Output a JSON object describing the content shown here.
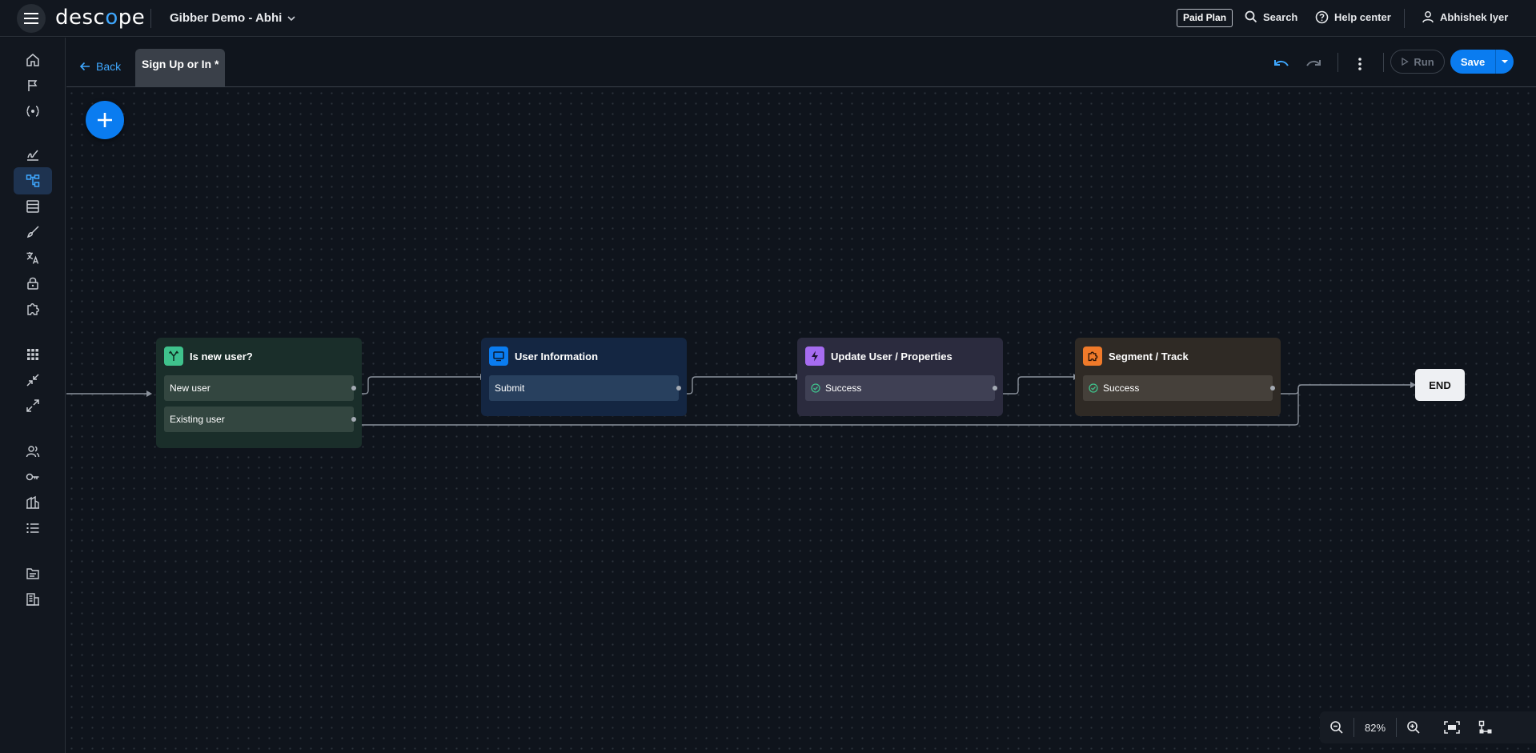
{
  "topbar": {
    "logo_prefix": "desc",
    "logo_o": "o",
    "logo_suffix": "pe",
    "project_name": "Gibber Demo - Abhi",
    "plan_badge": "Paid Plan",
    "search_label": "Search",
    "help_label": "Help center",
    "user_name": "Abhishek Iyer"
  },
  "flowbar": {
    "back_label": "Back",
    "tab_label": "Sign Up or In *",
    "run_label": "Run",
    "save_label": "Save"
  },
  "nodes": {
    "is_new_user": {
      "title": "Is new user?",
      "rows": [
        "New user",
        "Existing user"
      ]
    },
    "user_information": {
      "title": "User Information",
      "rows": [
        "Submit"
      ]
    },
    "update_user": {
      "title": "Update User / Properties",
      "rows": [
        "Success"
      ]
    },
    "segment_track": {
      "title": "Segment / Track",
      "rows": [
        "Success"
      ]
    },
    "end": {
      "label": "END"
    }
  },
  "zoom": {
    "level": "82%"
  },
  "colors": {
    "accent": "#0a7cf0",
    "condition_icon": "#3fc28c",
    "screen_icon": "#0a7cf0",
    "action_icon": "#a66cf0",
    "connector_icon": "#f07a2a"
  },
  "sidebar_icons": [
    "home-icon",
    "flag-icon",
    "code-icon",
    "signature-icon",
    "flows-icon",
    "table-icon",
    "brush-icon",
    "translate-icon",
    "lock-icon",
    "puzzle-icon",
    "apps-grid-icon",
    "collapse-icon",
    "expand-icon",
    "users-icon",
    "key-icon",
    "building-icon",
    "list-icon",
    "folder-icon",
    "company-icon"
  ]
}
